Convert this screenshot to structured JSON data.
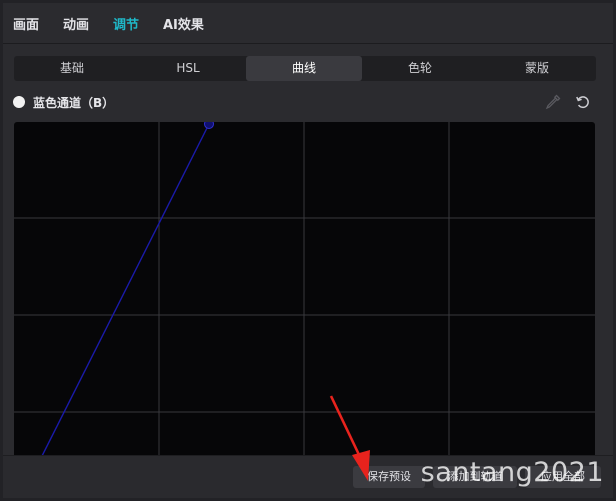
{
  "top_tabs": [
    {
      "label": "画面"
    },
    {
      "label": "动画"
    },
    {
      "label": "调节",
      "active": true
    },
    {
      "label": "AI效果"
    }
  ],
  "sub_tabs": [
    {
      "label": "基础"
    },
    {
      "label": "HSL"
    },
    {
      "label": "曲线",
      "active": true
    },
    {
      "label": "色轮"
    },
    {
      "label": "蒙版"
    }
  ],
  "channel": {
    "label": "蓝色通道（B）",
    "icons": [
      "eyedropper-icon",
      "reset-icon"
    ]
  },
  "curve": {
    "line_color": "#1a1aa8",
    "handle_color": "#101070",
    "grid_divisions": 4
  },
  "bottom_buttons": {
    "save_preset": "保存预设",
    "add_to_track": "添加到轨道",
    "apply_all": "应用全部"
  },
  "watermark": "santang2021",
  "colors": {
    "accent": "#1fb8c8",
    "arrow": "#e8231d"
  }
}
